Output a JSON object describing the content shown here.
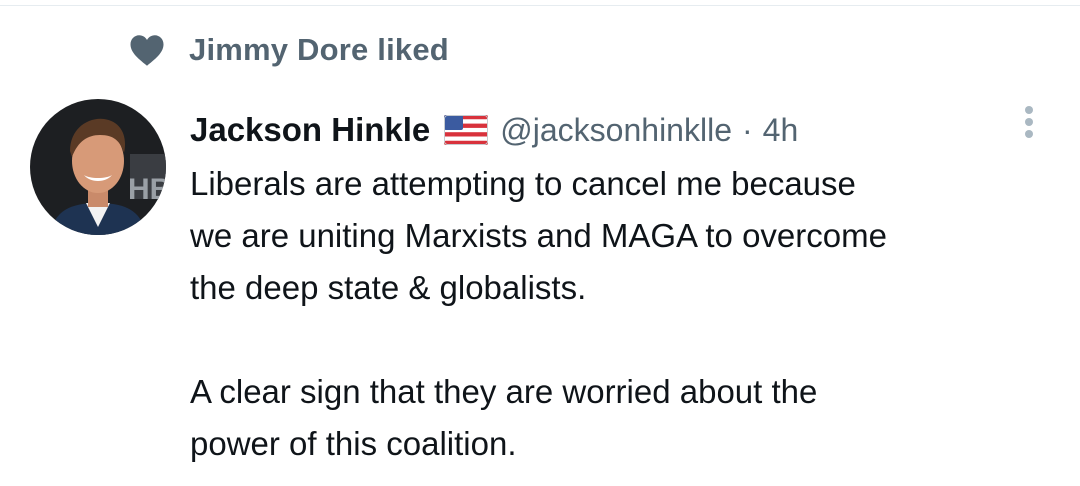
{
  "social_context": {
    "icon": "heart-icon",
    "text": "Jimmy Dore liked"
  },
  "tweet": {
    "author": {
      "name": "Jackson Hinkle",
      "flag_icon": "us-flag-icon",
      "handle": "@jacksonhinklle",
      "avatar_icon": "avatar"
    },
    "separator": "·",
    "timestamp": "4h",
    "more_icon": "more-vertical-icon",
    "paragraphs": [
      {
        "lines": [
          "Liberals are attempting to cancel me because",
          "we are uniting Marxists and MAGA to overcome",
          "the deep state & globalists."
        ]
      },
      {
        "lines": [
          "A clear sign that they are worried about the",
          "power of this coalition."
        ]
      }
    ]
  },
  "colors": {
    "secondary_text": "#536471",
    "primary_text": "#0f1419",
    "divider": "#e6ecf0"
  }
}
